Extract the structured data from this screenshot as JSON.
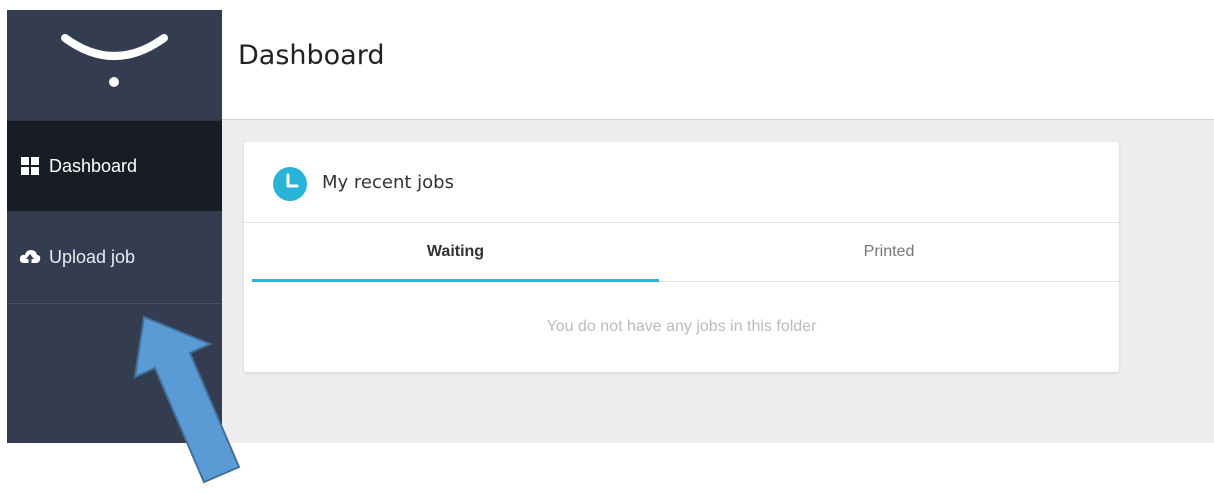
{
  "header": {
    "title": "Dashboard"
  },
  "sidebar": {
    "logo_icon": "logo-icon",
    "items": [
      {
        "label": "Dashboard",
        "icon": "grid-icon",
        "active": true
      },
      {
        "label": "Upload job",
        "icon": "cloud-upload-icon",
        "active": false
      }
    ]
  },
  "card": {
    "title": "My recent jobs",
    "icon": "clock-icon",
    "tabs": [
      {
        "label": "Waiting",
        "active": true
      },
      {
        "label": "Printed",
        "active": false
      }
    ],
    "empty_message": "You do not have any jobs in this folder"
  },
  "colors": {
    "sidebar_bg": "#333d4f",
    "sidebar_active_bg": "#181c24",
    "accent": "#27b4d6",
    "content_bg": "#eeeeee",
    "arrow_fill": "#5b9bd5",
    "arrow_stroke": "#41719c"
  }
}
